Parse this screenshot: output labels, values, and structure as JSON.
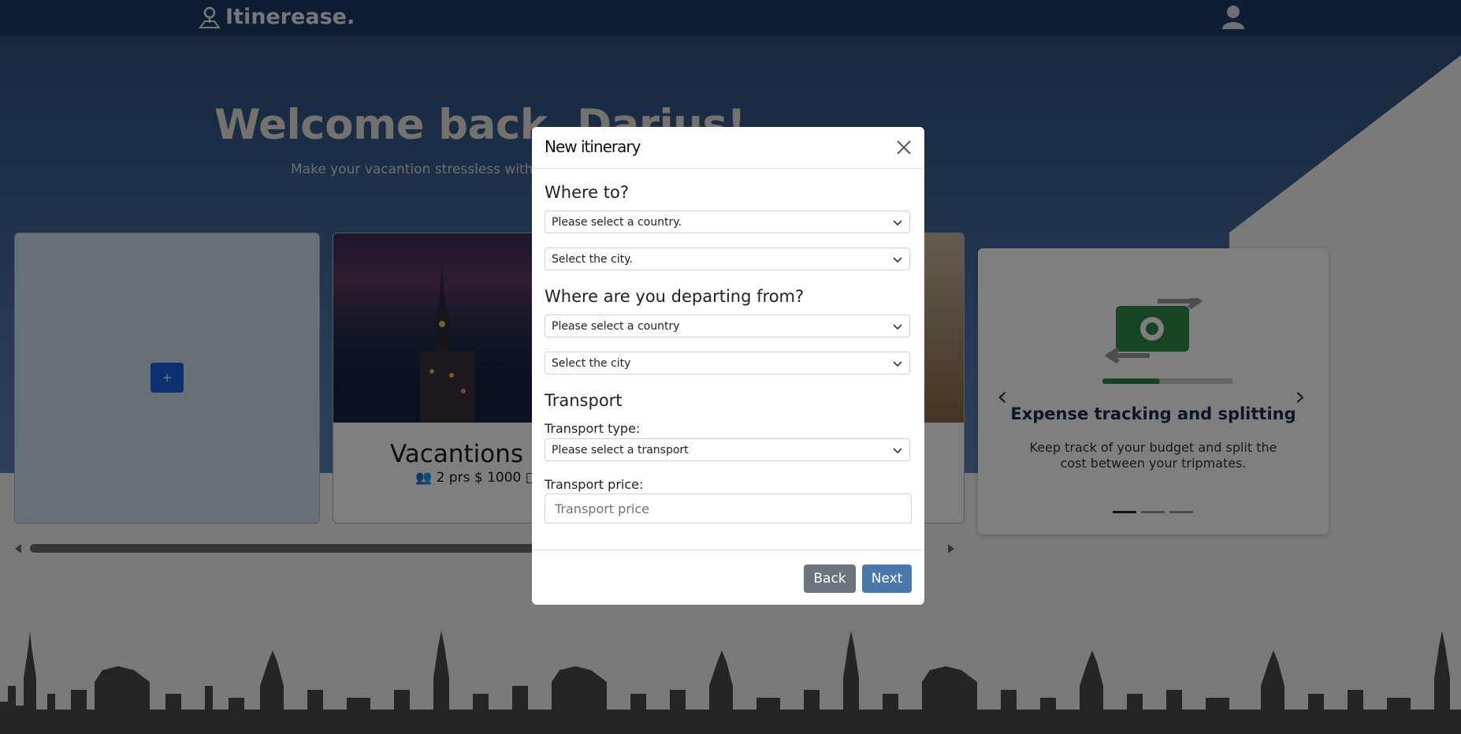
{
  "navbar": {
    "brand": "Itinerease."
  },
  "hero": {
    "welcome": "Welcome back, Darius!",
    "tagline": "Make your vacantion stressless with us"
  },
  "trips": {
    "add_label": "+",
    "card": {
      "title": "Vacantions Mallorca",
      "people": "2 prs",
      "budget": "$ 1000"
    }
  },
  "feature": {
    "title": "Expense tracking and splitting",
    "description": "Keep track of your budget and split the cost between your tripmates.",
    "slide_count": 3,
    "active_slide": 1,
    "progress_fraction": 0.36
  },
  "modal": {
    "title": "New itinerary",
    "where_to": {
      "heading": "Where to?",
      "country_placeholder": "Please select a country.",
      "city_placeholder": "Select the city."
    },
    "departing": {
      "heading": "Where are you departing from?",
      "country_placeholder": "Please select a country",
      "city_placeholder": "Select the city"
    },
    "transport": {
      "heading": "Transport",
      "type_label": "Transport type:",
      "type_placeholder": "Please select a transport",
      "price_label": "Transport price:",
      "price_placeholder": "Transport price"
    },
    "back_label": "Back",
    "next_label": "Next"
  },
  "colors": {
    "accent": "#4a78ad",
    "secondary": "#6c757d",
    "navbar": "#1e3a64",
    "add_button": "#1860e0",
    "progress": "#2e8b47"
  },
  "icons": [
    "pin-icon",
    "user-icon",
    "close-icon",
    "chevron-down-icon",
    "people-icon",
    "calendar-icon",
    "money-exchange-icon"
  ]
}
